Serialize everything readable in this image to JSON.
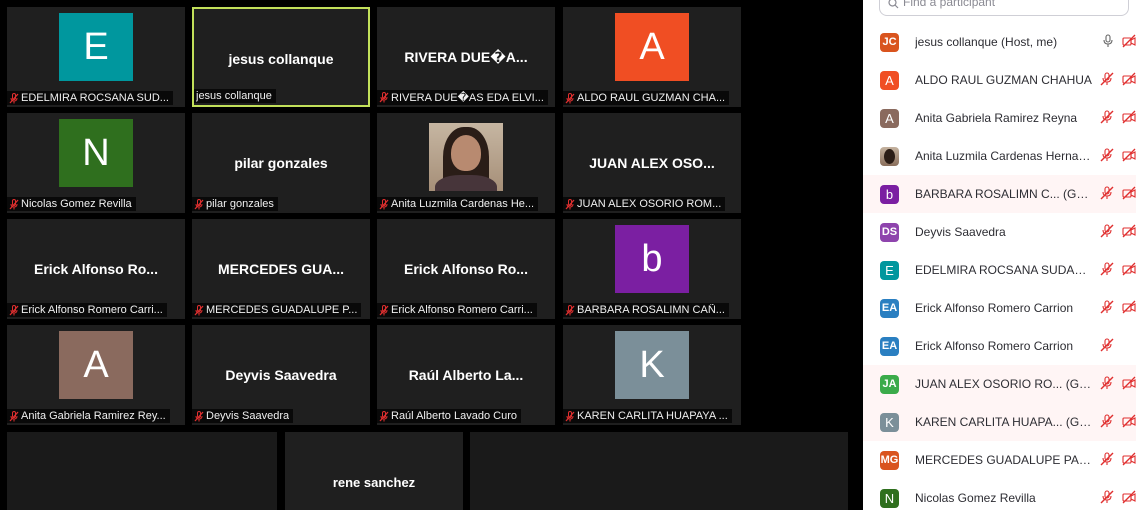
{
  "gallery": {
    "tiles": [
      {
        "label": "EDELMIRA ROCSANA  SUD...",
        "avatar_letter": "E",
        "avatar_color": "#00979e",
        "muted": true
      },
      {
        "label": "jesus collanque",
        "display_name": "jesus collanque",
        "muted": false,
        "active_speaker": true
      },
      {
        "label": "RIVERA DUE\u0000AS EDA ELVI...",
        "display_name": "RIVERA DUE\u0000A...",
        "muted": true
      },
      {
        "label": "ALDO RAUL GUZMAN CHA...",
        "avatar_letter": "A",
        "avatar_color": "#f04e23",
        "muted": true
      },
      {
        "label": "Nicolas Gomez Revilla",
        "avatar_letter": "N",
        "avatar_color": "#2f6f1e",
        "muted": true
      },
      {
        "label": "pilar gonzales",
        "display_name": "pilar gonzales",
        "muted": true
      },
      {
        "label": "Anita Luzmila Cardenas He...",
        "has_video": true,
        "muted": true
      },
      {
        "label": "JUAN ALEX OSORIO ROM...",
        "display_name": "JUAN ALEX OSO...",
        "muted": true
      },
      {
        "label": "Erick Alfonso Romero Carri...",
        "display_name": "Erick Alfonso Ro...",
        "muted": true
      },
      {
        "label": "MERCEDES GUADALUPE P...",
        "display_name": "MERCEDES GUA...",
        "muted": true
      },
      {
        "label": "Erick Alfonso Romero Carri...",
        "display_name": "Erick Alfonso Ro...",
        "muted": true
      },
      {
        "label": "BARBARA ROSALIMN CAÑ...",
        "avatar_letter": "b",
        "avatar_color": "#7b1fa2",
        "muted": true
      },
      {
        "label": "Anita Gabriela Ramirez Rey...",
        "avatar_letter": "A",
        "avatar_color": "#8a6a5e",
        "muted": true
      },
      {
        "label": "Deyvis Saavedra",
        "display_name": "Deyvis Saavedra",
        "muted": true
      },
      {
        "label": "Raúl Alberto Lavado Curo",
        "display_name": "Raúl Alberto La...",
        "muted": true
      },
      {
        "label": "KAREN CARLITA HUAPAYA ...",
        "avatar_letter": "K",
        "avatar_color": "#7b8f99",
        "muted": true
      }
    ],
    "last_tile": {
      "display_name": "rene sanchez"
    }
  },
  "panel": {
    "search_placeholder": "Find a participant",
    "participants": [
      {
        "initials": "JC",
        "color": "#d9541e",
        "name": "jesus collanque (Host, me)",
        "audio": "on",
        "video_off": true,
        "highlight": false
      },
      {
        "initials": "A",
        "color": "#f04e23",
        "name": "ALDO RAUL GUZMAN CHAHUA",
        "audio": "muted",
        "video_off": true,
        "highlight": false,
        "big": true
      },
      {
        "initials": "A",
        "color": "#8a6a5e",
        "name": "Anita Gabriela Ramirez Reyna",
        "audio": "muted",
        "video_off": true,
        "highlight": false,
        "big": true
      },
      {
        "photo": true,
        "name": "Anita Luzmila Cardenas Hernan...",
        "audio": "muted",
        "video_off": true,
        "highlight": false
      },
      {
        "initials": "b",
        "color": "#7b1fa2",
        "name": "BARBARA ROSALIMN C... (Guest)",
        "audio": "muted",
        "video_off": true,
        "highlight": true,
        "big": true
      },
      {
        "initials": "DS",
        "color": "#8e44ad",
        "name": "Deyvis Saavedra",
        "audio": "muted",
        "video_off": true,
        "highlight": false
      },
      {
        "initials": "E",
        "color": "#00979e",
        "name": "EDELMIRA ROCSANA  SUDARIO...",
        "audio": "muted",
        "video_off": true,
        "highlight": false,
        "big": true
      },
      {
        "initials": "EA",
        "color": "#2a7fc1",
        "name": "Erick Alfonso Romero Carrion",
        "audio": "muted",
        "video_off": true,
        "highlight": false
      },
      {
        "initials": "EA",
        "color": "#2a7fc1",
        "name": "Erick Alfonso Romero Carrion",
        "audio": "muted",
        "video_off": false,
        "highlight": false
      },
      {
        "initials": "JA",
        "color": "#3bab4a",
        "name": "JUAN ALEX OSORIO RO... (Guest)",
        "audio": "muted",
        "video_off": true,
        "highlight": true
      },
      {
        "initials": "K",
        "color": "#7b8f99",
        "name": "KAREN CARLITA HUAPA... (Guest)",
        "audio": "muted",
        "video_off": true,
        "highlight": true,
        "big": true
      },
      {
        "initials": "MG",
        "color": "#d9541e",
        "name": "MERCEDES GUADALUPE PALO...",
        "audio": "muted",
        "video_off": true,
        "highlight": false
      },
      {
        "initials": "N",
        "color": "#2f6f1e",
        "name": "Nicolas Gomez Revilla",
        "audio": "muted",
        "video_off": true,
        "highlight": false,
        "big": true
      }
    ]
  },
  "colors": {
    "muted_red": "#e02f2f",
    "active_border": "#c2e05a",
    "tile_bg": "#1f1f1f"
  }
}
